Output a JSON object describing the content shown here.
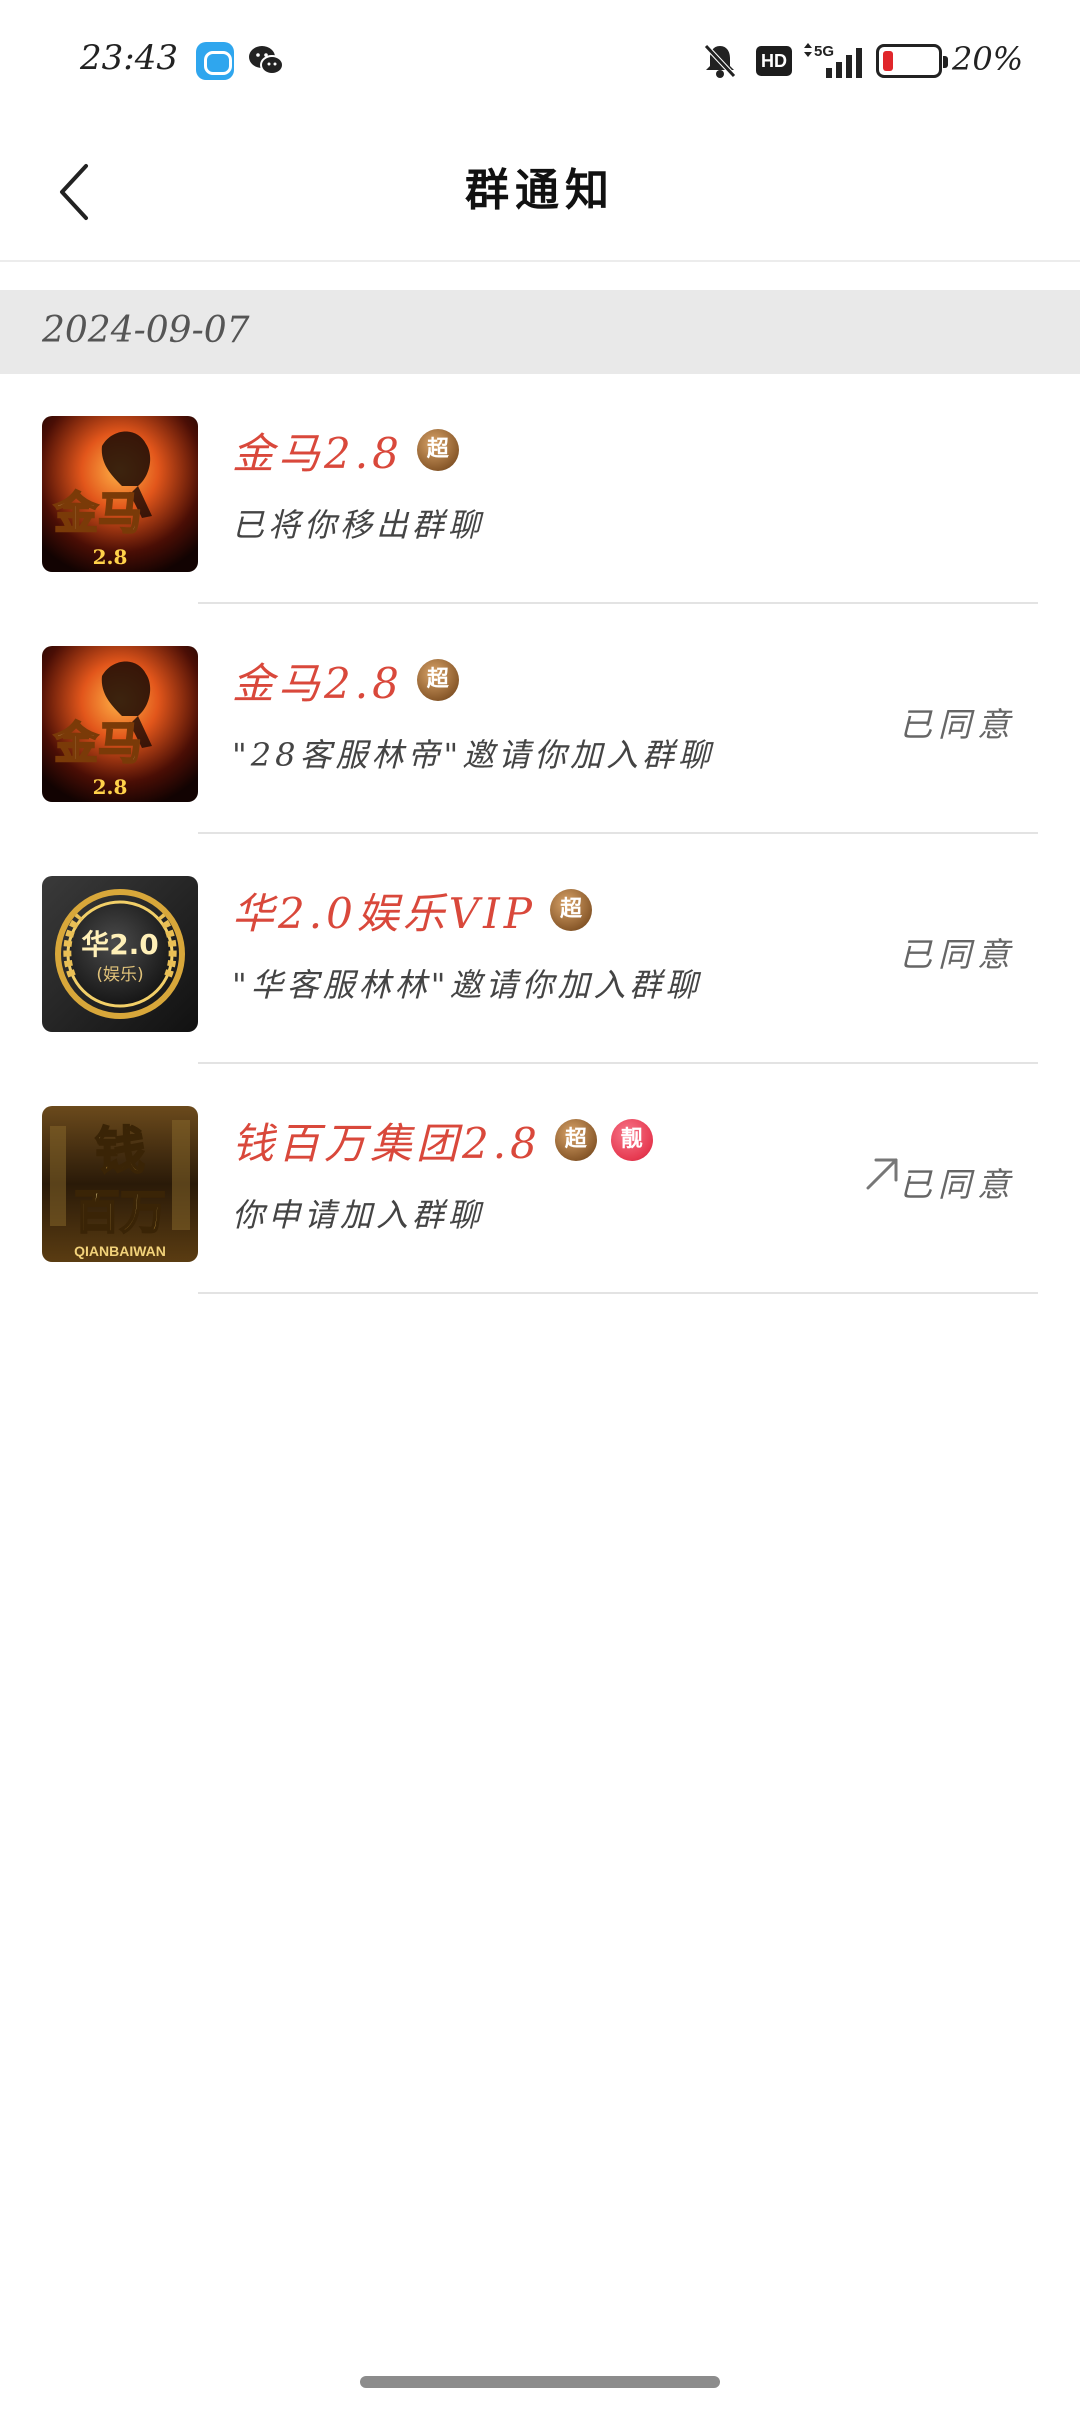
{
  "status_bar": {
    "time": "23:43",
    "battery_pct": "20%",
    "hd_label": "HD",
    "network": "5G",
    "icons": [
      "app-notification-icon",
      "wechat-icon",
      "mute-bell-icon",
      "hd-icon",
      "5g-signal-icon",
      "battery-icon"
    ],
    "battery_level": 0.2
  },
  "header": {
    "title": "群通知",
    "back_icon": "back-chevron-icon"
  },
  "date_section": {
    "date": "2024-09-07"
  },
  "notifications": [
    {
      "group_name": "金马2.8",
      "badges": [
        "超"
      ],
      "message": "已将你移出群聊",
      "status": "",
      "avatar": {
        "text": "金马",
        "sub": "2.8",
        "style": "horse"
      }
    },
    {
      "group_name": "金马2.8",
      "badges": [
        "超"
      ],
      "message": "\"28客服林帝\"邀请你加入群聊",
      "status": "已同意",
      "avatar": {
        "text": "金马",
        "sub": "2.8",
        "style": "horse"
      }
    },
    {
      "group_name": "华2.0娱乐VIP",
      "badges": [
        "超"
      ],
      "message": "\"华客服林林\"邀请你加入群聊",
      "status": "已同意",
      "avatar": {
        "text": "华2.0",
        "sub": "(娱乐)",
        "style": "laurel"
      }
    },
    {
      "group_name": "钱百万集团2.8",
      "badges": [
        "超",
        "靓"
      ],
      "message": "你申请加入群聊",
      "status": "已同意",
      "status_icon": "arrow-up-right-icon",
      "avatar": {
        "text": "钱",
        "text2": "百万",
        "sub": "QIANBAIWAN",
        "style": "gold"
      }
    }
  ],
  "colors": {
    "group_name": "#d9483b",
    "date_bar_bg": "#e9e9e9",
    "badge_chao": "#8a5a2b",
    "badge_liang": "#e63950"
  }
}
